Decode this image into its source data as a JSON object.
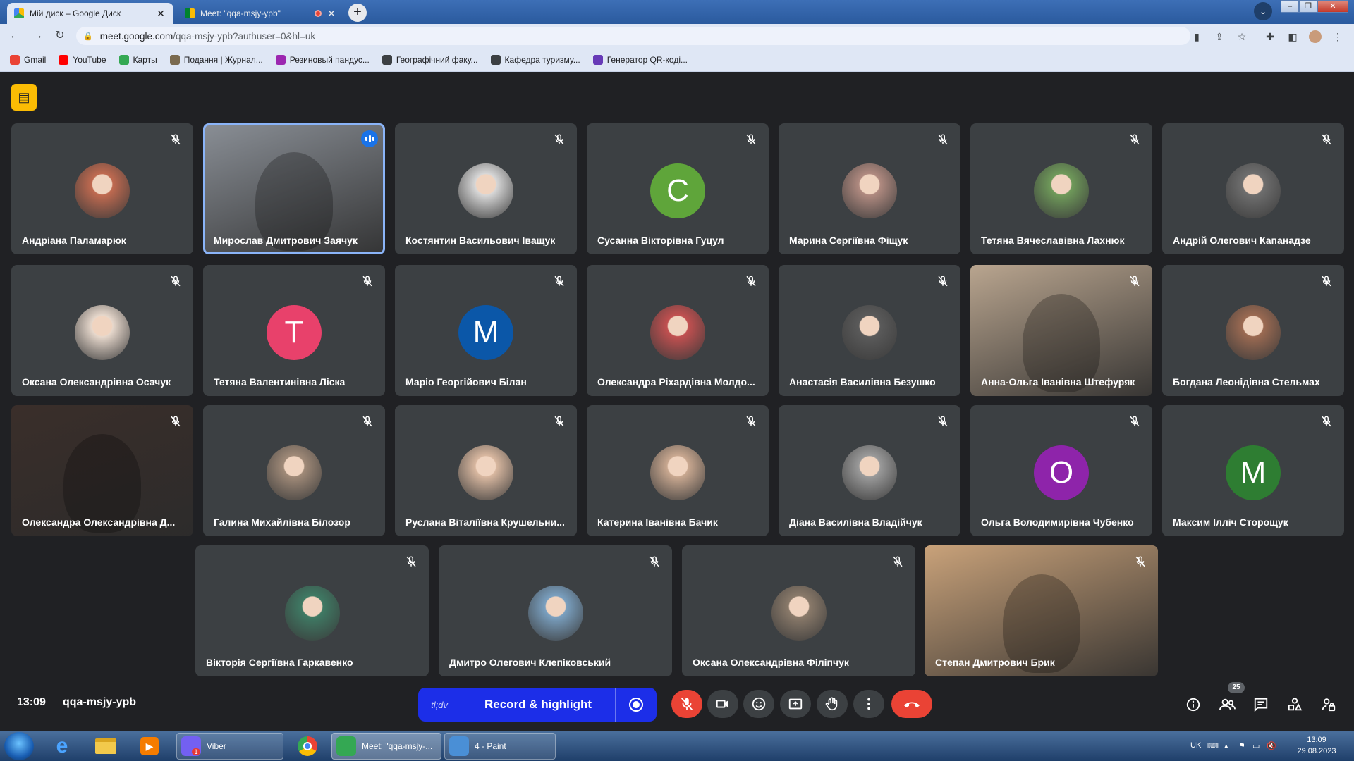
{
  "browser": {
    "tabs": [
      {
        "title": "Мій диск – Google Диск",
        "active": true,
        "icon": "google-drive-icon"
      },
      {
        "title": "Meet: \"qqa-msjy-ypb\"",
        "active": false,
        "icon": "google-meet-icon",
        "recording_indicator": true
      }
    ],
    "new_tab_label": "+",
    "url_host": "meet.google.com",
    "url_path": "/qqa-msjy-ypb?authuser=0&hl=uk",
    "bookmarks": [
      {
        "label": "Gmail",
        "icon": "gmail-icon",
        "color": "#ea4335"
      },
      {
        "label": "YouTube",
        "icon": "youtube-icon",
        "color": "#ff0000"
      },
      {
        "label": "Карты",
        "icon": "maps-icon",
        "color": "#34a853"
      },
      {
        "label": "Подання | Журнал...",
        "icon": "journal-icon",
        "color": "#7a6a4f"
      },
      {
        "label": "Резиновый пандус...",
        "icon": "page-icon",
        "color": "#9c27b0"
      },
      {
        "label": "Географічний факу...",
        "icon": "globe-icon",
        "color": "#3c4043"
      },
      {
        "label": "Кафедра туризму...",
        "icon": "globe-icon",
        "color": "#3c4043"
      },
      {
        "label": "Генератор QR-коді...",
        "icon": "qr-icon",
        "color": "#673ab7"
      }
    ]
  },
  "meet": {
    "time": "13:09",
    "meeting_code": "qqa-msjy-ypb",
    "participant_count": "25",
    "record_brand": "tl;dv",
    "record_label": "Record & highlight",
    "participants": [
      {
        "name": "Андріана Паламарюк",
        "avatar": "photo",
        "color": "#c06a50",
        "muted": true
      },
      {
        "name": "Мирослав Дмитрович Заячук",
        "avatar": "video",
        "color": "#8a8f96",
        "muted": false,
        "speaking": true
      },
      {
        "name": "Костянтин Васильович Іващук",
        "avatar": "photo",
        "color": "#d8d8d8",
        "muted": true
      },
      {
        "name": "Сусанна Вікторівна Гуцул",
        "avatar": "letter",
        "letter": "С",
        "color": "#5fa53a",
        "muted": true
      },
      {
        "name": "Марина Сергіївна Фіщук",
        "avatar": "photo",
        "color": "#b08a80",
        "muted": true
      },
      {
        "name": "Тетяна Вячеславівна Лахнюк",
        "avatar": "photo",
        "color": "#6f9a5a",
        "muted": true
      },
      {
        "name": "Андрій Олегович Капанадзе",
        "avatar": "photo",
        "color": "#6e6e6e",
        "muted": true
      },
      {
        "name": "Оксана Олександрівна Осачук",
        "avatar": "photo",
        "color": "#e7d8cc",
        "muted": true
      },
      {
        "name": "Тетяна Валентинівна Ліска",
        "avatar": "letter",
        "letter": "T",
        "color": "#e8416b",
        "muted": true
      },
      {
        "name": "Маріо Георгійович Білан",
        "avatar": "letter",
        "letter": "M",
        "color": "#0b57a8",
        "muted": true
      },
      {
        "name": "Олександра Ріхардівна Молдо...",
        "avatar": "photo",
        "color": "#c25050",
        "muted": true
      },
      {
        "name": "Анастасія Василівна Безушко",
        "avatar": "photo",
        "color": "#5a5a5a",
        "muted": true
      },
      {
        "name": "Анна-Ольга Іванівна Штефуряк",
        "avatar": "video",
        "color": "#b9a58f",
        "muted": true
      },
      {
        "name": "Богдана Леонідівна Стельмах",
        "avatar": "photo",
        "color": "#9b6a52",
        "muted": true
      },
      {
        "name": "Олександра Олександрівна Д...",
        "avatar": "video",
        "color": "#3a2e2a",
        "muted": true
      },
      {
        "name": "Галина Михайлівна Білозор",
        "avatar": "photo",
        "color": "#a08a78",
        "muted": true
      },
      {
        "name": "Руслана Віталіївна Крушельни...",
        "avatar": "photo",
        "color": "#d9b8a0",
        "muted": true
      },
      {
        "name": "Катерина Іванівна Бачик",
        "avatar": "photo",
        "color": "#c9a890",
        "muted": true
      },
      {
        "name": "Діана Василівна Владійчук",
        "avatar": "photo",
        "color": "#9a9a9a",
        "muted": true
      },
      {
        "name": "Ольга Володимирівна Чубенко",
        "avatar": "letter",
        "letter": "O",
        "color": "#8e24aa",
        "muted": true
      },
      {
        "name": "Максим Ілліч Сторощук",
        "avatar": "letter",
        "letter": "M",
        "color": "#2e7d32",
        "muted": true
      },
      {
        "name": "Вікторія Сергіївна Гаркавенко",
        "avatar": "photo",
        "color": "#3f7a64",
        "muted": true
      },
      {
        "name": "Дмитро Олегович Клепіковський",
        "avatar": "photo",
        "color": "#7aa0c0",
        "muted": true
      },
      {
        "name": "Оксана Олександрівна Філіпчук",
        "avatar": "photo",
        "color": "#8a7a6a",
        "muted": true
      },
      {
        "name": "Степан Дмитрович Брик",
        "avatar": "video",
        "color": "#c9a27a",
        "muted": true
      }
    ]
  },
  "taskbar": {
    "apps": [
      {
        "label": "Viber",
        "icon": "viber-icon",
        "badge": "1"
      },
      {
        "label": "Meet: \"qqa-msjy-...",
        "icon": "chrome-icon"
      },
      {
        "label": "4 - Paint",
        "icon": "paint-icon"
      }
    ],
    "lang": "UK",
    "time": "13:09",
    "date": "29.08.2023"
  }
}
